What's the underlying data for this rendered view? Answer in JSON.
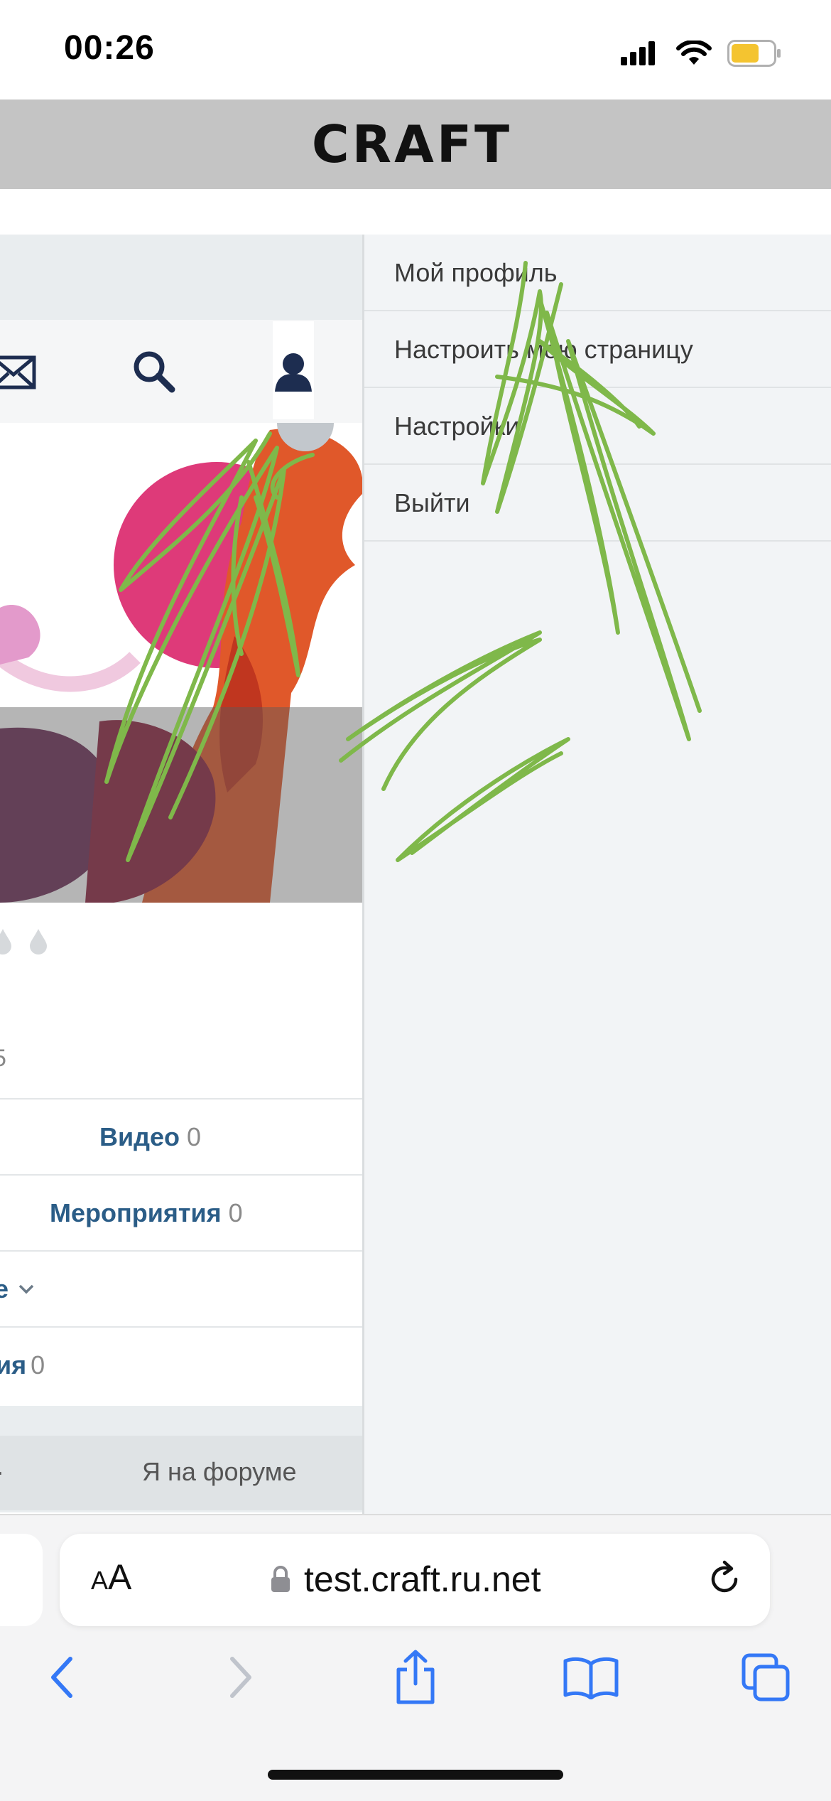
{
  "status_bar": {
    "time": "00:26"
  },
  "header": {
    "logo": "CRAFT"
  },
  "profile_page": {
    "partial_text": "5",
    "rows": [
      {
        "label": "Видео",
        "count": "0"
      },
      {
        "label": "Мероприятия",
        "count": "0"
      },
      {
        "label": "е",
        "count": ""
      },
      {
        "label": "ия",
        "count": "0"
      }
    ],
    "forum_label": "Я на форуме"
  },
  "dropdown": {
    "items": [
      {
        "label": "Мой профиль"
      },
      {
        "label": "Настроить мою страницу"
      },
      {
        "label": "Настройки"
      },
      {
        "label": "Выйти"
      }
    ]
  },
  "browser": {
    "text_size_label_small": "A",
    "text_size_label_large": "A",
    "url": "test.craft.ru.net"
  },
  "colors": {
    "header_bg": "#c4c4c4",
    "link_blue": "#2b5d87",
    "ios_blue": "#3478f6",
    "scribble_green": "#7fb84a"
  },
  "icons": [
    "mail-icon",
    "search-icon",
    "user-icon",
    "lock-icon",
    "reload-icon",
    "back-icon",
    "forward-icon",
    "share-icon",
    "bookmarks-icon",
    "tabs-icon"
  ]
}
